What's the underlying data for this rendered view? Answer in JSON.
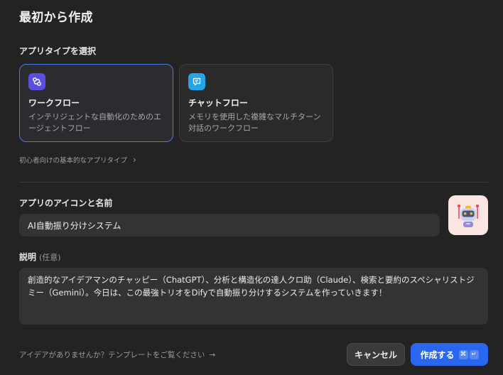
{
  "dialog": {
    "title": "最初から作成",
    "app_type_label": "アプリタイプを選択"
  },
  "app_types": [
    {
      "name": "ワークフロー",
      "description": "インテリジェントな自動化のためのエージェントフロー",
      "icon": "workflow-icon",
      "icon_color": "#5b4fe0",
      "selected": true
    },
    {
      "name": "チャットフロー",
      "description": "メモリを使用した複雑なマルチターン対話のワークフロー",
      "icon": "chatflow-icon",
      "icon_color": "#21a4e8",
      "selected": false
    }
  ],
  "beginner_link": {
    "label": "初心者向けの基本的なアプリタイプ",
    "icon": "chevron-right-icon"
  },
  "app_name": {
    "label": "アプリのアイコンと名前",
    "value": "AI自動振り分けシステム",
    "icon": "robot-icon",
    "icon_background": "#fbe5e3"
  },
  "description": {
    "label": "説明",
    "optional": "(任意)",
    "value": "創造的なアイデアマンのチャッピー（ChatGPT）、分析と構造化の達人クロ助（Claude）、検索と要約のスペシャリストジミー（Gemini）。今日は、この最強トリオをDifyで自動振り分けするシステムを作っていきます！"
  },
  "footer": {
    "idea_link": "アイデアがありませんか？テンプレートをご覧ください",
    "idea_icon": "arrow-right-icon",
    "cancel_label": "キャンセル",
    "create_label": "作成する",
    "shortcut_keys": [
      "⌘",
      "↵"
    ]
  },
  "colors": {
    "background": "#232323",
    "accent": "#2a66f0",
    "selected_border": "#4d7de0"
  }
}
